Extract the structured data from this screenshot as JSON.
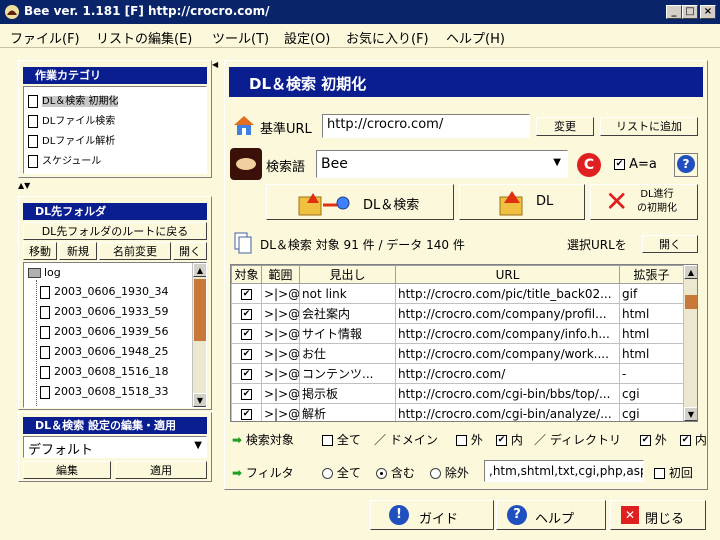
{
  "window": {
    "title": "Bee ver. 1.181 [F]  http://crocro.com/"
  },
  "menu": [
    "ファイル(F)",
    "リストの編集(E)",
    "ツール(T)",
    "設定(O)",
    "お気に入り(F)",
    "ヘルプ(H)"
  ],
  "category": {
    "header": "作業カテゴリ",
    "items": [
      "DL＆検索 初期化",
      "DLファイル検索",
      "DLファイル解析",
      "スケジュール"
    ],
    "selected_index": 0
  },
  "folder": {
    "header": "DL先フォルダ",
    "root_button": "DL先フォルダのルートに戻る",
    "buttons": [
      "移動",
      "新規",
      "名前変更",
      "開く"
    ],
    "root": "log",
    "items": [
      "2003_0606_1930_34",
      "2003_0606_1933_59",
      "2003_0606_1939_56",
      "2003_0606_1948_25",
      "2003_0608_1516_18",
      "2003_0608_1518_33"
    ]
  },
  "settings": {
    "header": "DL＆検索 設定の編集・適用",
    "selected": "デフォルト",
    "edit_label": "編集",
    "apply_label": "適用"
  },
  "main": {
    "header": "DL＆検索 初期化",
    "base_url_label": "基準URL",
    "base_url": "http://crocro.com/",
    "change_label": "変更",
    "add_list_label": "リストに追加",
    "search_label": "検索語",
    "search_value": "Bee",
    "case_label": "A=a",
    "dl_search_label": "DL＆検索",
    "dl_label": "DL",
    "reset_line1": "DL進行",
    "reset_line2": "の初期化",
    "summary": "DL＆検索  対象 91 件 / データ 140 件",
    "select_url_label": "選択URLを",
    "open_label": "開く"
  },
  "table": {
    "columns": [
      "対象",
      "範囲",
      "見出し",
      "URL",
      "拡張子"
    ],
    "rows": [
      {
        "scope": ">|>@",
        "title": "not link",
        "url": "http://crocro.com/pic/title_back02...",
        "ext": "gif"
      },
      {
        "scope": ">|>@",
        "title": "会社案内",
        "url": "http://crocro.com/company/profil...",
        "ext": "html"
      },
      {
        "scope": ">|>@",
        "title": "サイト情報",
        "url": "http://crocro.com/company/info.h...",
        "ext": "html"
      },
      {
        "scope": ">|>@",
        "title": "お仕",
        "url": "http://crocro.com/company/work....",
        "ext": "html"
      },
      {
        "scope": ">|>@",
        "title": "コンテンツ...",
        "url": "http://crocro.com/",
        "ext": "-"
      },
      {
        "scope": ">|>@",
        "title": "掲示板",
        "url": "http://crocro.com/cgi-bin/bbs/top/...",
        "ext": "cgi"
      },
      {
        "scope": ">|>@",
        "title": "解析",
        "url": "http://crocro.com/cgi-bin/analyze/...",
        "ext": "cgi"
      }
    ]
  },
  "target": {
    "label": "検索対象",
    "all": "全て",
    "domain_label": "／ ドメイン",
    "domain_out": "外",
    "domain_in": "内",
    "dir_label": "／ ディレクトリ",
    "dir_out": "外",
    "dir_in": "内"
  },
  "filter": {
    "label": "フィルタ",
    "all": "全て",
    "include": "含む",
    "exclude": "除外",
    "value": ",htm,shtml,txt,cgi,php,asp",
    "first_label": "初回"
  },
  "footer": {
    "guide": "ガイド",
    "help": "ヘルプ",
    "close": "閉じる"
  }
}
